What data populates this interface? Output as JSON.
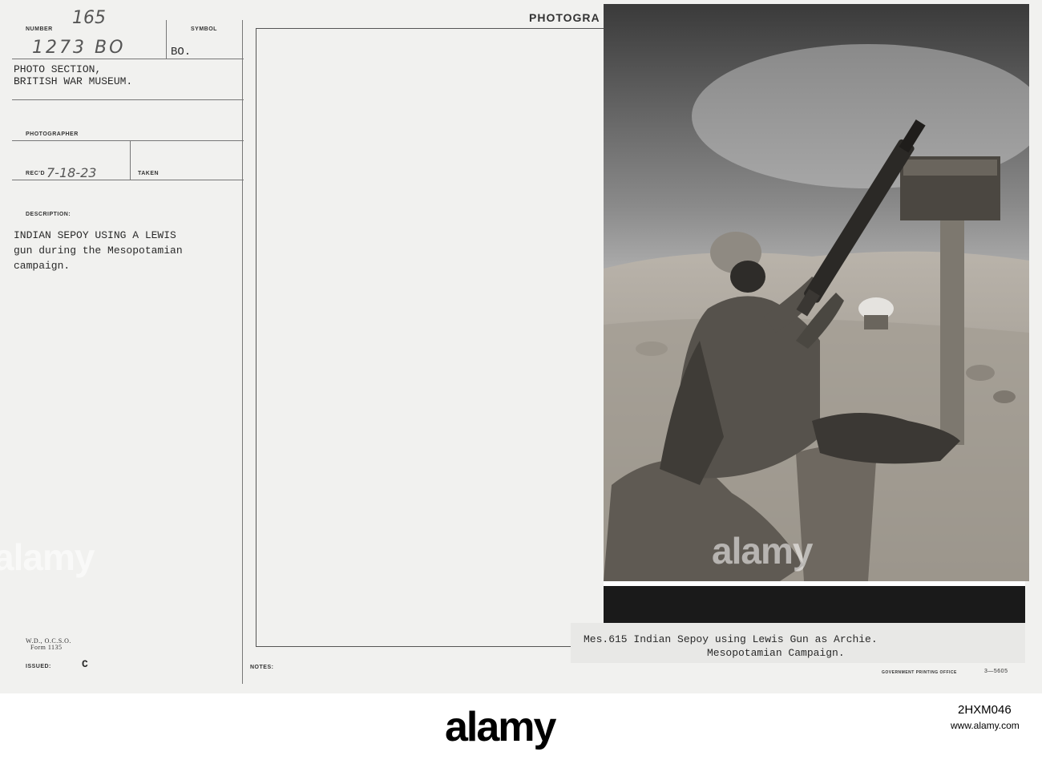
{
  "card": {
    "number_label": "NUMBER",
    "number_handwritten": "165",
    "number_value": "1273 BO",
    "symbol_label": "SYMBOL",
    "symbol_value": "BO.",
    "source_line1": "PHOTO SECTION,",
    "source_line2": "BRITISH WAR MUSEUM.",
    "photographer_label": "PHOTOGRAPHER",
    "recd_label": "REC'D",
    "recd_value": "7-18-23",
    "taken_label": "TAKEN",
    "description_label": "DESCRIPTION:",
    "description_line1": "INDIAN SEPOY USING A LEWIS",
    "description_line2": "gun during the Mesopotamian",
    "description_line3": "campaign.",
    "form_line1": "W.D., O.C.S.O.",
    "form_line2": "Form 1135",
    "issued_label": "ISSUED:",
    "issued_value": "C",
    "notes_label": "NOTES:",
    "photograph_header": "PHOTOGRA",
    "caption_line1": "Mes.615   Indian Sepoy using Lewis Gun as Archie.",
    "caption_line2": "Mesopotamian Campaign.",
    "printing_office": "GOVERNMENT PRINTING OFFICE",
    "form_number": "3—5605"
  },
  "watermark": {
    "text_left": "alamy",
    "text_right": "alamy",
    "bottom_logo": "alamy",
    "image_id": "2HXM046",
    "site": "www.alamy.com"
  }
}
